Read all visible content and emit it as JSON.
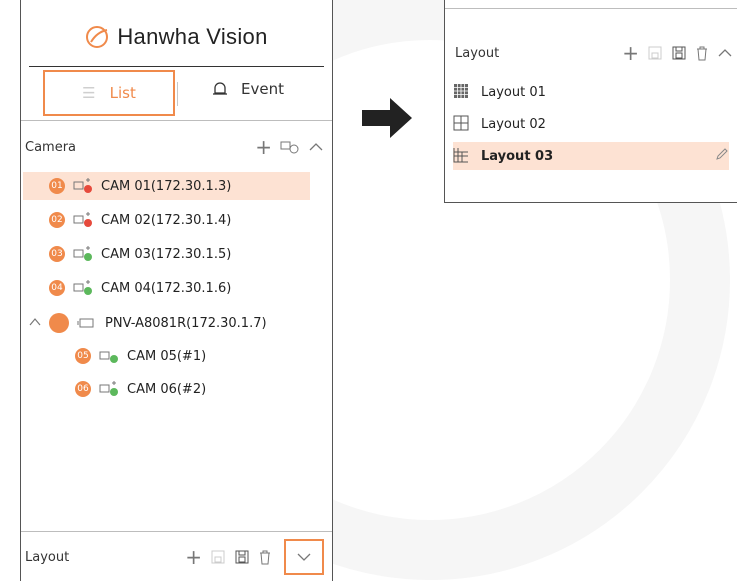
{
  "brand": {
    "name": "Hanwha Vision"
  },
  "tabs": [
    {
      "label": "List",
      "icon": "list-icon",
      "active": true
    },
    {
      "label": "Event",
      "icon": "bell-icon",
      "active": false
    }
  ],
  "camera_section": {
    "title": "Camera",
    "items": [
      {
        "badge": "01",
        "label": "CAM 01(172.30.1.3)",
        "selected": true
      },
      {
        "badge": "02",
        "label": "CAM 02(172.30.1.4)"
      },
      {
        "badge": "03",
        "label": "CAM 03(172.30.1.5)"
      },
      {
        "badge": "04",
        "label": "CAM 04(172.30.1.6)"
      },
      {
        "label": "PNV-A8081R(172.30.1.7)",
        "group": true
      },
      {
        "badge": "05",
        "label": "CAM 05(#1)",
        "child": true
      },
      {
        "badge": "06",
        "label": "CAM 06(#2)",
        "child": true
      }
    ]
  },
  "layout_section_collapsed": {
    "title": "Layout"
  },
  "layout_section_expanded": {
    "title": "Layout",
    "items": [
      {
        "label": "Layout 01",
        "icon": "grid-4x4-icon"
      },
      {
        "label": "Layout 02",
        "icon": "grid-2x2-icon"
      },
      {
        "label": "Layout 03",
        "icon": "grid-custom-icon",
        "selected": true
      }
    ]
  },
  "colors": {
    "accent": "#f08a4b",
    "selection": "#fde2d3",
    "border": "#555555"
  }
}
